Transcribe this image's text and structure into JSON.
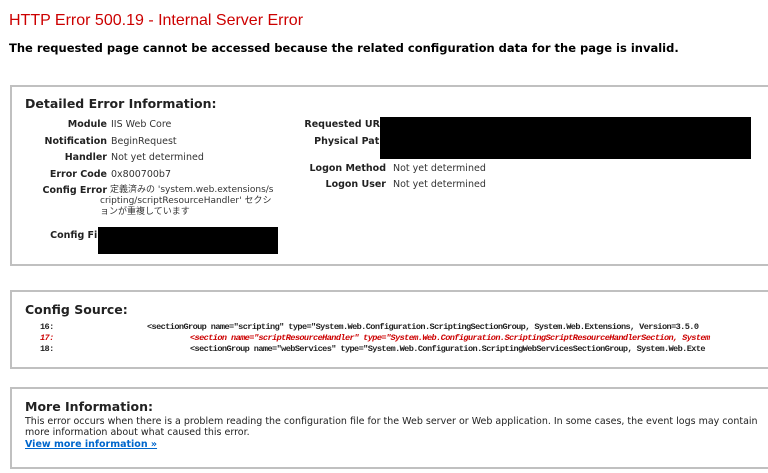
{
  "title": "HTTP Error 500.19 - Internal Server Error",
  "subtitle": "The requested page cannot be accessed because the related configuration data for the page is invalid.",
  "detailed": {
    "heading": "Detailed Error Information:",
    "left": [
      {
        "label": "Module",
        "value": "IIS Web Core"
      },
      {
        "label": "Notification",
        "value": "BeginRequest"
      },
      {
        "label": "Handler",
        "value": "Not yet determined"
      },
      {
        "label": "Error Code",
        "value": "0x800700b7"
      },
      {
        "label": "Config Error",
        "value": "定義済みの 'system.web.extensions/scripting/scriptResourceHandler' セクションが重複しています"
      },
      {
        "label": "Config File",
        "value": ""
      }
    ],
    "right": [
      {
        "label": "Requested URL",
        "value": ""
      },
      {
        "label": "Physical Path",
        "value": ""
      },
      {
        "label": "Logon Method",
        "value": "Not yet determined"
      },
      {
        "label": "Logon User",
        "value": "Not yet determined"
      }
    ]
  },
  "config_source": {
    "heading": "Config Source:",
    "lines": [
      {
        "num": "16:",
        "code": "<sectionGroup name=\"scripting\" type=\"System.Web.Configuration.ScriptingSectionGroup, System.Web.Extensions, Version=3.5.0"
      },
      {
        "num": "17:",
        "code": "<section name=\"scriptResourceHandler\" type=\"System.Web.Configuration.ScriptingScriptResourceHandlerSection, System"
      },
      {
        "num": "18:",
        "code": "<sectionGroup name=\"webServices\" type=\"System.Web.Configuration.ScriptingWebServicesSectionGroup, System.Web.Exte"
      }
    ]
  },
  "more_info": {
    "heading": "More Information:",
    "text": "This error occurs when there is a problem reading the configuration file for the Web server or Web application. In some cases, the event logs may contain more information about what caused this error.",
    "link": "View more information »"
  },
  "colors": {
    "title": "#cc0000",
    "link": "#0066cc",
    "border": "#c0c0c0"
  }
}
